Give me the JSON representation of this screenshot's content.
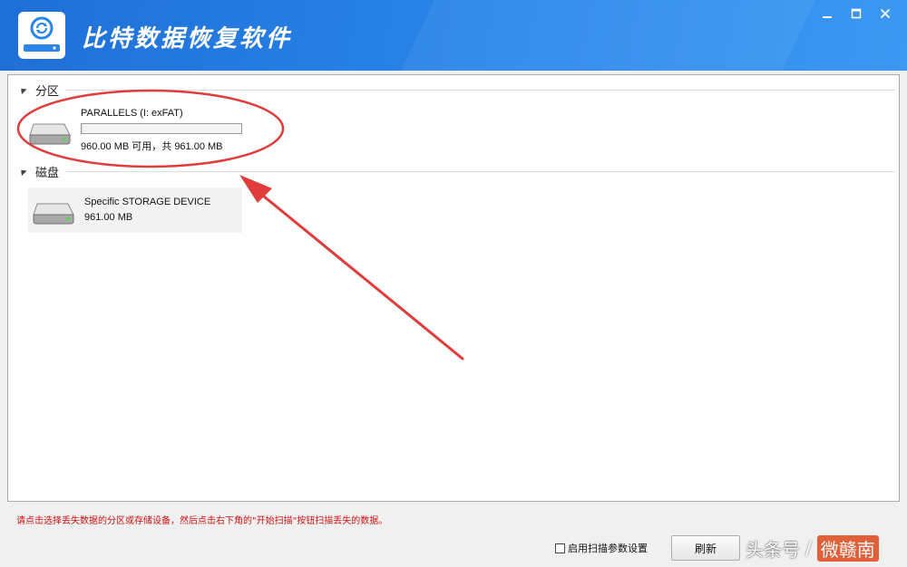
{
  "app": {
    "title": "比特数据恢复软件",
    "accent_color": "#2a86ea",
    "logo_icon": "disk-recovery-logo-icon"
  },
  "window_controls": [
    {
      "name": "minimize-icon"
    },
    {
      "name": "maximize-icon"
    },
    {
      "name": "close-icon"
    }
  ],
  "partitions": {
    "label": "分区",
    "items": [
      {
        "name": "PARALLELS (I: exFAT)",
        "size": "960.00 MB 可用，共 961.00 MB",
        "used_fraction": 0.001,
        "icon": "hard-drive-icon"
      }
    ]
  },
  "disks": {
    "label": "磁盘",
    "items": [
      {
        "name": "Specific STORAGE DEVICE",
        "size": "961.00 MB",
        "icon": "hard-drive-icon"
      }
    ]
  },
  "annotation_color": "#e03c3c",
  "footer": {
    "hint": "请点击选择丢失数据的分区或存储设备，然后点击右下角的\"开始扫描\"按钮扫描丢失的数据。",
    "scan_option_label": "启用扫描参数设置",
    "scan_option_checked": false,
    "refresh_label": "刷新"
  },
  "watermark": {
    "source": "头条号",
    "author": "微赣南"
  }
}
